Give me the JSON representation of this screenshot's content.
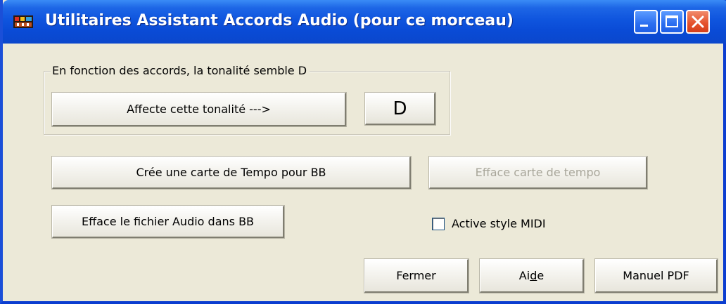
{
  "window": {
    "title": "Utilitaires Assistant Accords Audio (pour ce morceau)"
  },
  "key_group": {
    "legend": "En fonction des accords, la tonalité semble D",
    "set_key_button": "Affecte cette tonalité --->",
    "detected_key": "D"
  },
  "tempo": {
    "create_map_button": "Crée une carte de Tempo pour BB",
    "clear_map_button": "Efface carte de tempo",
    "clear_map_enabled": false
  },
  "audio": {
    "clear_audio_button": "Efface le fichier Audio dans BB"
  },
  "midi_style": {
    "label": "Active style MIDI",
    "checked": false
  },
  "footer": {
    "close_button": "Fermer",
    "help_button": "Aide",
    "pdf_manual_button": "Manuel PDF"
  },
  "colors": {
    "titlebar": "#0a4bd6",
    "client_background": "#ece9d8",
    "close_button": "#e4502a",
    "disabled_text": "#a8a69a"
  },
  "icons": {
    "app": "band-in-a-box-icon",
    "minimize": "minimize-icon",
    "maximize": "maximize-icon",
    "close": "close-icon"
  }
}
